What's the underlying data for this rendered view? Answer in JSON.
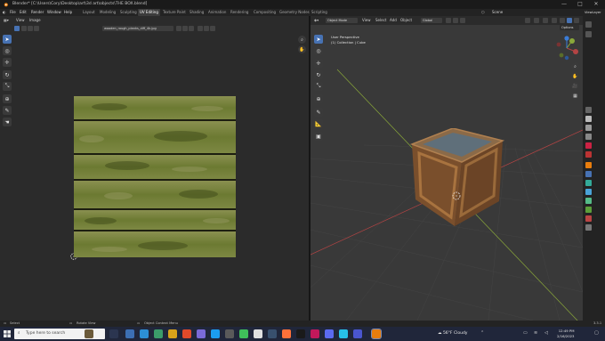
{
  "window": {
    "title": "Blender* [C:\\Users\\Cory\\Desktop\\art\\3d art\\objects\\THE BOX.blend]",
    "minimize": "—",
    "maximize": "□",
    "close": "✕"
  },
  "menu": {
    "items": [
      "File",
      "Edit",
      "Render",
      "Window",
      "Help"
    ],
    "workspaces": [
      "Layout",
      "Modeling",
      "Sculpting",
      "UV Editing",
      "Texture Paint",
      "Shading",
      "Animation",
      "Rendering",
      "Compositing",
      "Geometry Nodes",
      "Scripting"
    ],
    "active_workspace": "UV Editing",
    "scene": "Scene",
    "view_layer": "ViewLayer"
  },
  "uv_editor": {
    "menus": [
      "View",
      "Image"
    ],
    "image_name": "wooden_rough_planks_diff_4k.jpg"
  },
  "viewport": {
    "mode": "Object Mode",
    "menus": [
      "View",
      "Select",
      "Add",
      "Object"
    ],
    "transform": "Global",
    "perspective_label": "User Perspective",
    "collection_label": "(1) Collection | Cube",
    "options": "Options",
    "gizmo": {
      "x": "X",
      "y": "Y",
      "z": "Z"
    }
  },
  "statusbar": {
    "left": "Select",
    "middle": "Rotate View",
    "right": "Object Context Menu",
    "version": "3.3.1"
  },
  "taskbar": {
    "search_placeholder": "Type here to search",
    "weather_temp": "56°F",
    "weather_text": "Cloudy",
    "time": "12:49 PM",
    "date": "2/16/2023"
  },
  "colors": {
    "accent": "#4772b3",
    "panel": "#2b2b2b",
    "viewport_bg": "#393939",
    "axis_x": "#b34444",
    "axis_y": "#8aa83a"
  }
}
